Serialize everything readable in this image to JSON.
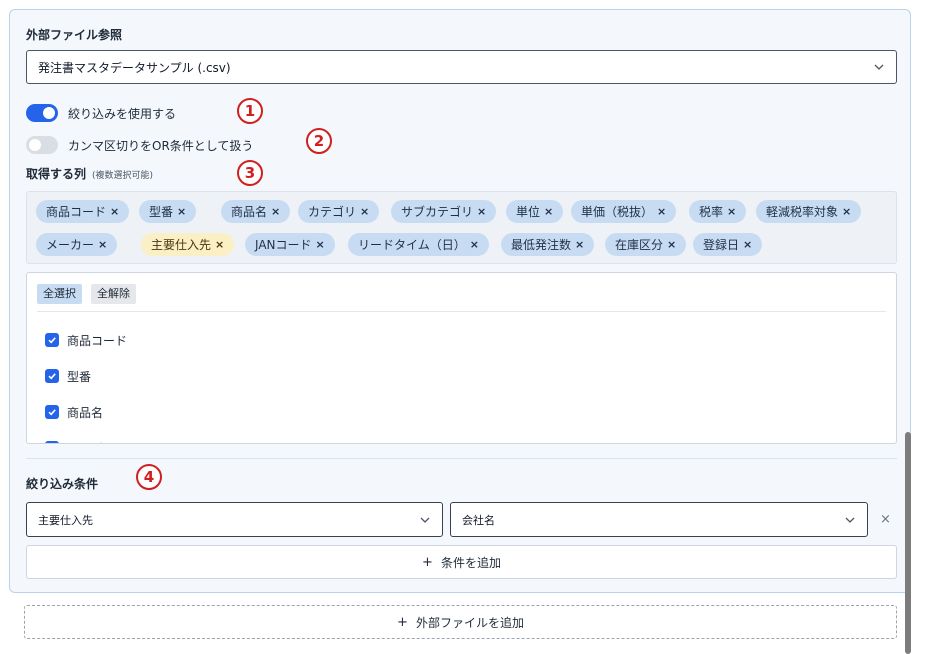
{
  "file_ref": {
    "label": "外部ファイル参照",
    "selected_file": "発注書マスタデータサンプル (.csv)"
  },
  "options": {
    "use_filter": {
      "label": "絞り込みを使用する",
      "on": true
    },
    "comma_or": {
      "label": "カンマ区切りをOR条件として扱う",
      "on": false
    }
  },
  "columns": {
    "label": "取得する列",
    "hint": "(複数選択可能)",
    "chips": [
      {
        "label": "商品コード",
        "highlight": false
      },
      {
        "label": "型番",
        "highlight": false
      },
      {
        "label": "商品名",
        "highlight": false
      },
      {
        "label": "カテゴリ",
        "highlight": false
      },
      {
        "label": "サブカテゴリ",
        "highlight": false
      },
      {
        "label": "単位",
        "highlight": false
      },
      {
        "label": "単価（税抜）",
        "highlight": false
      },
      {
        "label": "税率",
        "highlight": false
      },
      {
        "label": "軽減税率対象",
        "highlight": false
      },
      {
        "label": "メーカー",
        "highlight": false
      },
      {
        "label": "主要仕入先",
        "highlight": true
      },
      {
        "label": "JANコード",
        "highlight": false
      },
      {
        "label": "リードタイム（日）",
        "highlight": false
      },
      {
        "label": "最低発注数",
        "highlight": false
      },
      {
        "label": "在庫区分",
        "highlight": false
      },
      {
        "label": "登録日",
        "highlight": false
      }
    ],
    "remove_symbol": "×",
    "select_all": "全選択",
    "clear_all": "全解除",
    "list_items": [
      {
        "label": "商品コード",
        "checked": true
      },
      {
        "label": "型番",
        "checked": true
      },
      {
        "label": "商品名",
        "checked": true
      },
      {
        "label": "カテゴリ",
        "checked": true
      }
    ]
  },
  "filter": {
    "label": "絞り込み条件",
    "condition_field": "主要仕入先",
    "condition_value": "会社名",
    "remove_symbol": "×",
    "add_condition": "条件を追加"
  },
  "add_file": "外部ファイルを追加",
  "annotations": [
    "1",
    "2",
    "3",
    "4"
  ],
  "colors": {
    "accent": "#2563eb",
    "annotation": "#d11f1f",
    "chip": "#c7dcf3",
    "chip_highlight": "#fbefc6"
  }
}
